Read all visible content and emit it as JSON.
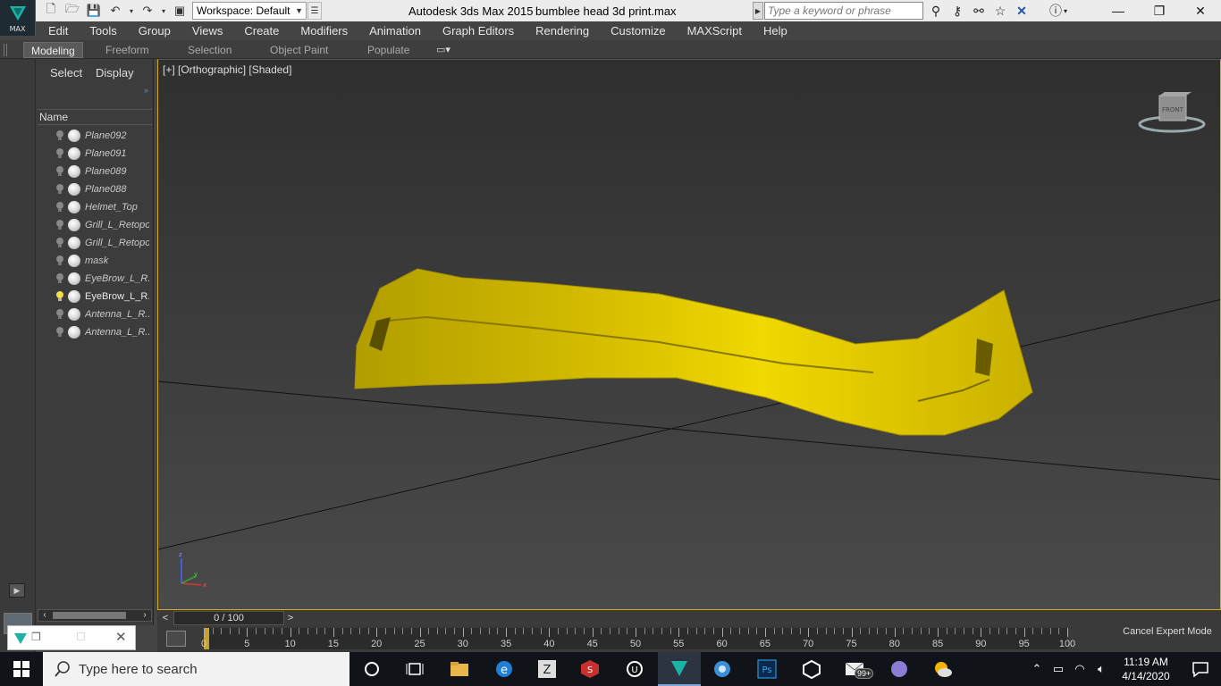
{
  "window": {
    "app_logo_label": "MAX",
    "title": "Autodesk 3ds Max  2015",
    "file_name": "bumblee head 3d print.max",
    "workspace": "Workspace: Default",
    "search_placeholder": "Type a keyword or phrase"
  },
  "menu": [
    "Edit",
    "Tools",
    "Group",
    "Views",
    "Create",
    "Modifiers",
    "Animation",
    "Graph Editors",
    "Rendering",
    "Customize",
    "MAXScript",
    "Help"
  ],
  "ribbon_tabs": [
    "Modeling",
    "Freeform",
    "Selection",
    "Object Paint",
    "Populate"
  ],
  "explorer": {
    "tabs": [
      "Select",
      "Display"
    ],
    "column_header": "Name",
    "objects": [
      {
        "name": "Plane092",
        "active": false
      },
      {
        "name": "Plane091",
        "active": false
      },
      {
        "name": "Plane089",
        "active": false
      },
      {
        "name": "Plane088",
        "active": false
      },
      {
        "name": "Helmet_Top",
        "active": false
      },
      {
        "name": "Grill_L_Retopo",
        "active": false
      },
      {
        "name": "Grill_L_Retopo",
        "active": false
      },
      {
        "name": "mask",
        "active": false
      },
      {
        "name": "EyeBrow_L_R...",
        "active": false
      },
      {
        "name": "EyeBrow_L_R...",
        "active": true
      },
      {
        "name": "Antenna_L_R...",
        "active": false
      },
      {
        "name": "Antenna_L_R...",
        "active": false
      }
    ]
  },
  "viewport": {
    "label": "[+] [Orthographic] [Shaded]",
    "viewcube_face": "FRONT",
    "object_color": "#e0c800"
  },
  "timeline": {
    "frame_readout": "0 / 100",
    "current_frame": 0,
    "tick_labels": [
      "0",
      "5",
      "10",
      "15",
      "20",
      "25",
      "30",
      "35",
      "40",
      "45",
      "50",
      "55",
      "60",
      "65",
      "70",
      "75",
      "80",
      "85",
      "90",
      "95",
      "100"
    ]
  },
  "status": {
    "expert_mode": "Cancel Expert Mode"
  },
  "taskbar": {
    "search_text": "Type here to search",
    "time": "11:19 AM",
    "date": "4/14/2020",
    "mail_badge": "99+"
  },
  "colors": {
    "accent_viewport_border": "#d6a820",
    "ui_dark": "#444444",
    "max_teal": "#1bb3a8"
  }
}
